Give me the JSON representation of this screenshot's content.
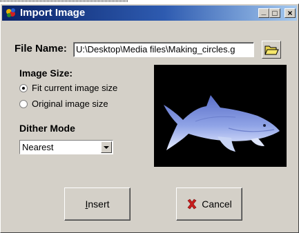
{
  "window": {
    "title": "Import Image",
    "controls": {
      "minimize": "_",
      "maximize": "□",
      "close": "×"
    }
  },
  "file": {
    "label": "File Name:",
    "value": "U:\\Desktop\\Media files\\Making_circles.g"
  },
  "image_size": {
    "label": "Image Size:",
    "options": [
      {
        "label": "Fit current image size",
        "checked": true
      },
      {
        "label": "Original image size",
        "checked": false
      }
    ]
  },
  "dither": {
    "label": "Dither Mode",
    "selected": "Nearest"
  },
  "buttons": {
    "insert": "Insert",
    "cancel": "Cancel"
  },
  "icons": {
    "app": "app-logo-icon",
    "folder": "folder-open-icon",
    "cancel": "red-x-icon"
  }
}
